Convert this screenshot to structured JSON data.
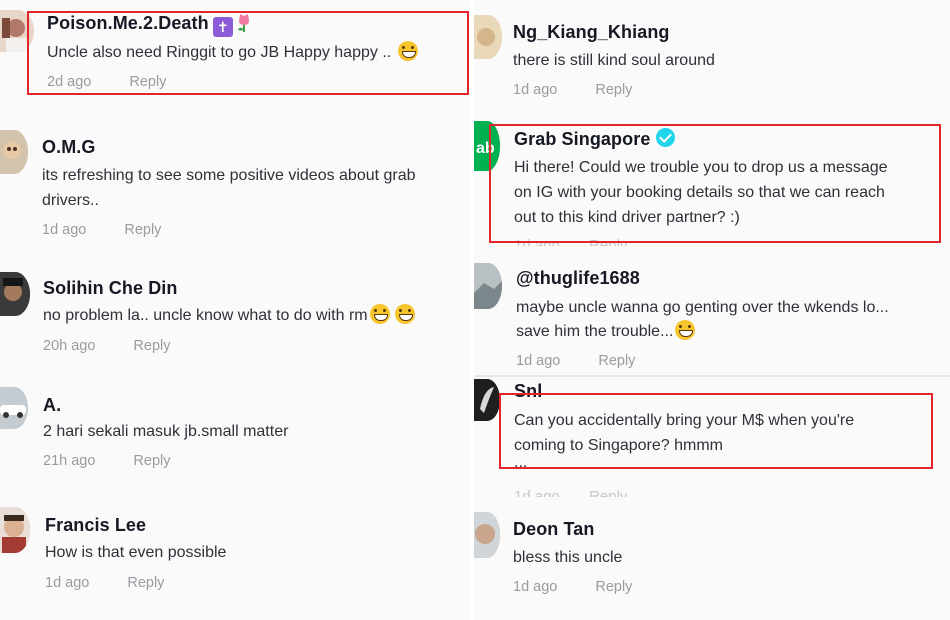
{
  "left": {
    "comments": [
      {
        "username": "Poison.Me.2.Death",
        "text": "Uncle also need Ringgit to go JB Happy happy ..",
        "time": "2d ago",
        "reply": "Reply",
        "badge_cross": "✝",
        "avatar_color": "#d8c3b8"
      },
      {
        "partial_name": "... ...... ......",
        "username": "O.M.G",
        "text_lines": [
          "its refreshing to see some positive videos about grab",
          "drivers.."
        ],
        "time": "1d ago",
        "reply": "Reply",
        "avatar_color": "#c8b7a0"
      },
      {
        "username": "Solihin Che Din",
        "text": "no problem la.. uncle know what to do with rm",
        "time": "20h ago",
        "reply": "Reply",
        "avatar_color": "#2f2f2f"
      },
      {
        "username": "A.",
        "text": "2 hari sekali masuk jb.small matter",
        "time": "21h ago",
        "reply": "Reply",
        "avatar_color": "#b9c2c7"
      },
      {
        "username": "Francis Lee",
        "text": "How is that even possible",
        "time": "1d ago",
        "reply": "Reply",
        "avatar_color": "#c79a84"
      }
    ]
  },
  "right": {
    "comments": [
      {
        "username": "Ng_Kiang_Khiang",
        "text": "there is still kind soul around",
        "time": "1d ago",
        "reply": "Reply",
        "avatar_color": "#e2d2b0"
      },
      {
        "username": "Grab Singapore",
        "text_lines": [
          "Hi there! Could we trouble you to drop us a message",
          "on IG with your booking details so that we can reach",
          "out to this kind driver partner? :)"
        ],
        "avatar_color": "#00b14f",
        "avatar_text": "ab"
      },
      {
        "username": "@thuglife1688",
        "text_lines": [
          "maybe uncle wanna go genting over the wkends lo...",
          "save him the trouble..."
        ],
        "time": "1d ago",
        "reply": "Reply",
        "avatar_color": "#9aa3a8"
      },
      {
        "username": "Snl",
        "text_lines": [
          "Can you accidentally bring your M$ when you're",
          "coming to Singapore? hmmm",
          "..."
        ],
        "avatar_color": "#2a2a2a"
      },
      {
        "username": "Deon Tan",
        "text": "bless this uncle",
        "time": "1d ago",
        "reply": "Reply",
        "avatar_color": "#c9a58e"
      }
    ]
  },
  "colors": {
    "highlight": "#e0262b",
    "verified": "#20d5ec",
    "muted": "#9a9ba1"
  }
}
